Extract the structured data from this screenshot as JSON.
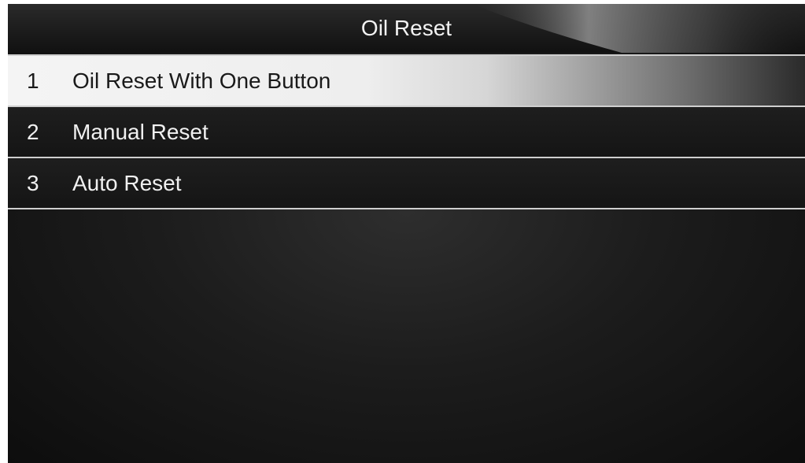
{
  "title": "Oil Reset",
  "menu": {
    "items": [
      {
        "number": "1",
        "label": "Oil Reset With One Button",
        "selected": true
      },
      {
        "number": "2",
        "label": "Manual Reset",
        "selected": false
      },
      {
        "number": "3",
        "label": "Auto Reset",
        "selected": false
      }
    ]
  },
  "colors": {
    "background": "#1c1c1c",
    "title_text": "#f2f2f2",
    "selected_highlight": "#f4f4f4",
    "divider": "#cfcfcf"
  }
}
